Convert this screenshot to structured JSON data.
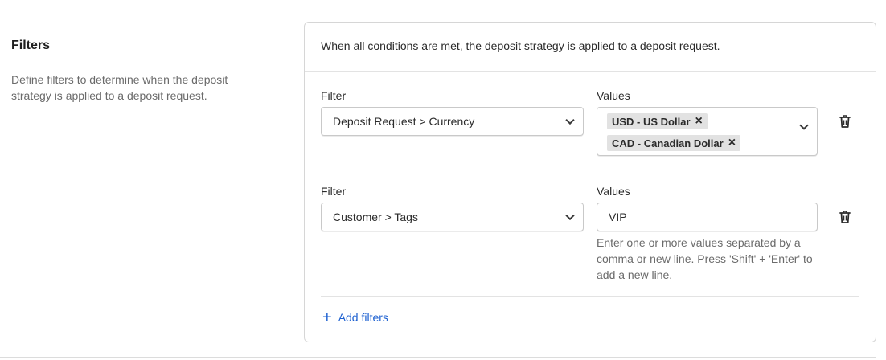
{
  "section": {
    "title": "Filters",
    "description": "Define filters to determine when the deposit strategy is applied to a deposit request."
  },
  "card": {
    "intro": "When all conditions are met, the deposit strategy is applied to a deposit request."
  },
  "filters": [
    {
      "filter_label": "Filter",
      "filter_value": "Deposit Request > Currency",
      "values_label": "Values",
      "chips": [
        "USD - US Dollar",
        "CAD - Canadian Dollar"
      ]
    },
    {
      "filter_label": "Filter",
      "filter_value": "Customer > Tags",
      "values_label": "Values",
      "input_value": "VIP",
      "help": "Enter one or more values separated by a comma or new line. Press 'Shift' + 'Enter' to add a new line."
    }
  ],
  "add_filters": {
    "icon": "plus-icon",
    "label": "Add filters"
  },
  "colors": {
    "accent": "#1b5fd0",
    "chip_bg": "#e2e2e2",
    "border": "#c9c9c9"
  }
}
